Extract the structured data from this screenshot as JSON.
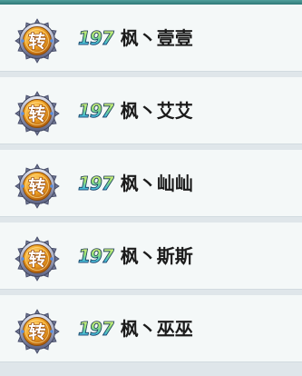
{
  "colors": {
    "top_bar": "#2f7877",
    "row_background": "#f4f8f8",
    "row_separator": "#dfe6ea",
    "badge_fill": "#f0a21c",
    "badge_ring": "#8b90a8",
    "name_text": "#1b1b1b"
  },
  "rows": [
    {
      "badge": "转",
      "badge_icon": "reincarnation-badge-icon",
      "level": "197",
      "name": "枫丶壹壹"
    },
    {
      "badge": "转",
      "badge_icon": "reincarnation-badge-icon",
      "level": "197",
      "name": "枫丶艾艾"
    },
    {
      "badge": "转",
      "badge_icon": "reincarnation-badge-icon",
      "level": "197",
      "name": "枫丶屾屾"
    },
    {
      "badge": "转",
      "badge_icon": "reincarnation-badge-icon",
      "level": "197",
      "name": "枫丶斯斯"
    },
    {
      "badge": "转",
      "badge_icon": "reincarnation-badge-icon",
      "level": "197",
      "name": "枫丶巫巫"
    }
  ]
}
